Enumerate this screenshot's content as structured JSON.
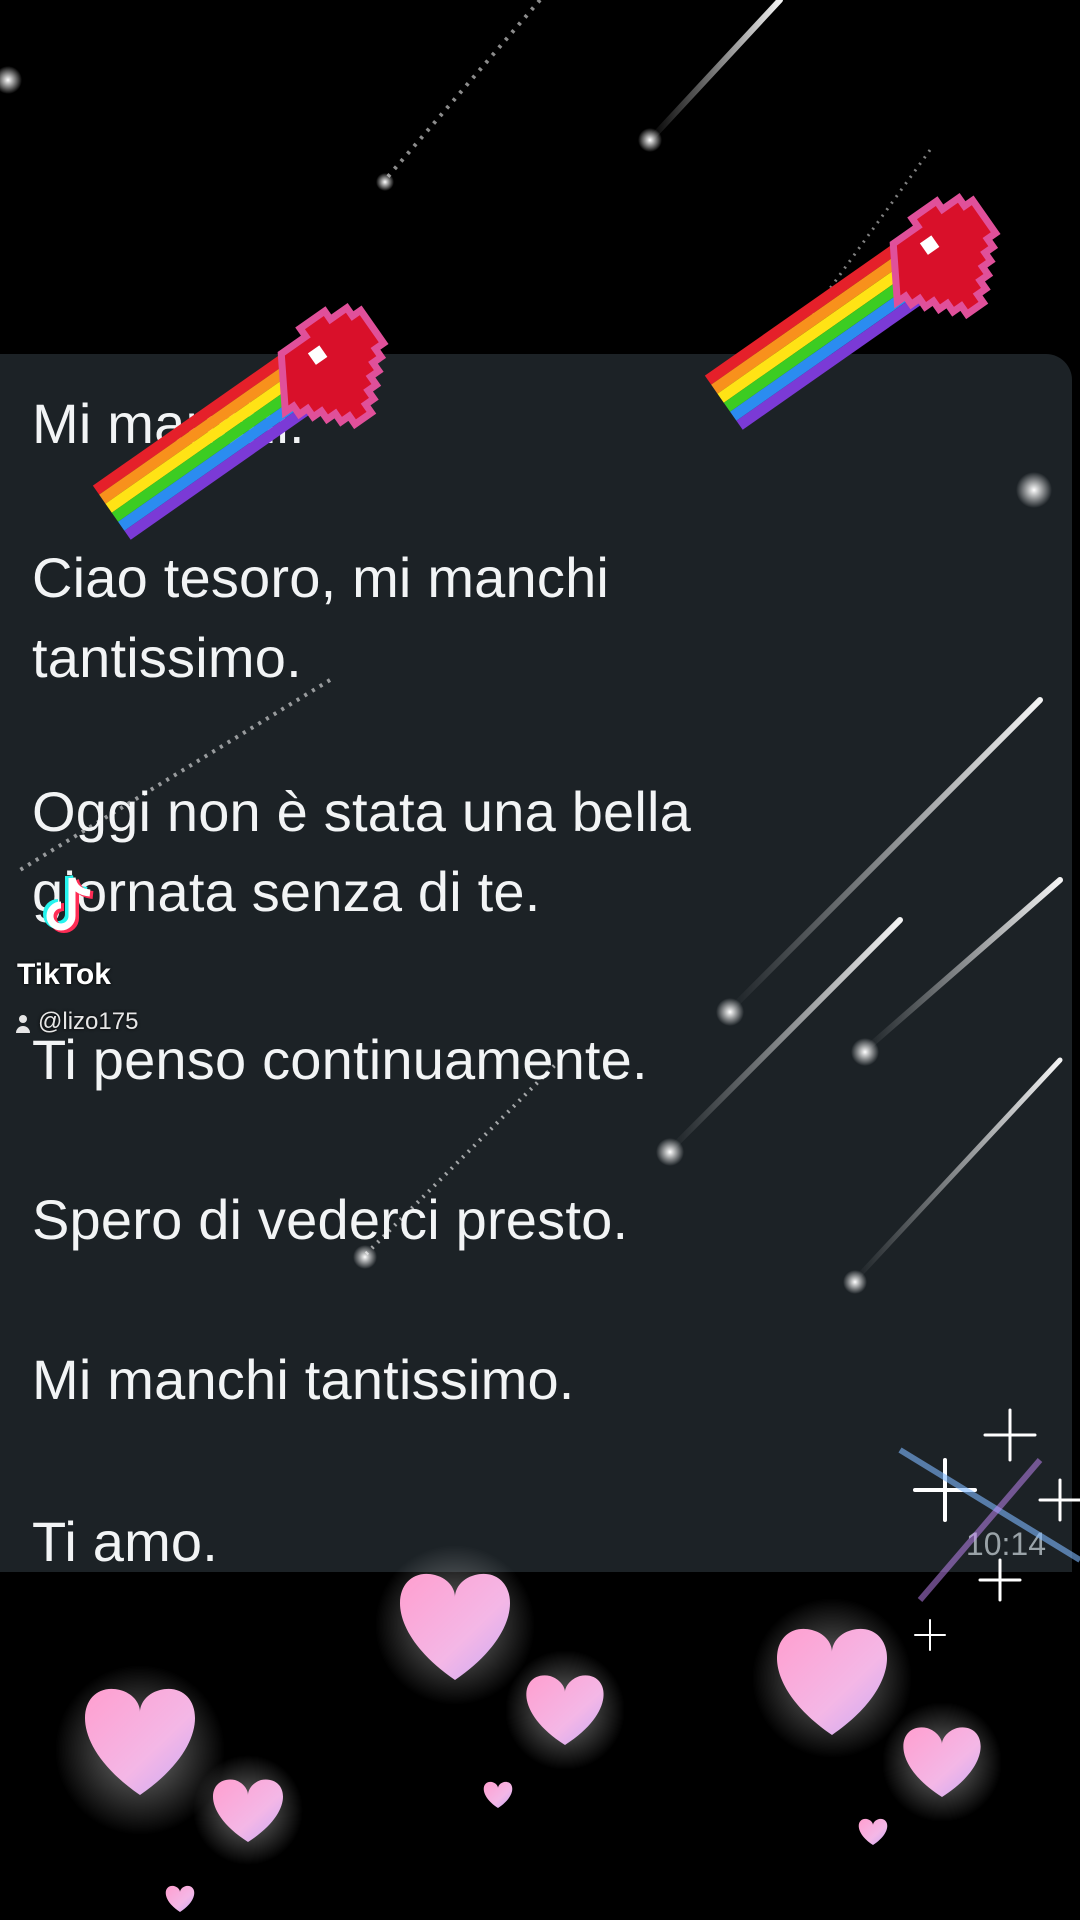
{
  "message": {
    "lines": [
      "Mi manchi.",
      "Ciao tesoro, mi manchi",
      "tantissimo.",
      "Oggi non è stata una bella",
      "giornata senza di te.",
      "Ti penso continuamente.",
      "Spero di vederci presto.",
      "Mi manchi tantissimo.",
      "Ti amo."
    ],
    "timestamp": "10:14"
  },
  "watermark": {
    "brand": "TikTok",
    "username": "@lizo175",
    "logo_icon": "tiktok-logo-icon",
    "user_icon": "user-icon"
  },
  "decorations": {
    "stickers": [
      "rainbow-heart-icon",
      "pink-heart-icon",
      "shooting-star-icon",
      "sparkle-icon"
    ]
  },
  "colors": {
    "background": "#000000",
    "bubble": "#1c2226",
    "text": "#f2f4f5",
    "heart_red": "#d9102a",
    "heart_outline": "#e0509a",
    "pink_heart": "#f6a9d6"
  }
}
